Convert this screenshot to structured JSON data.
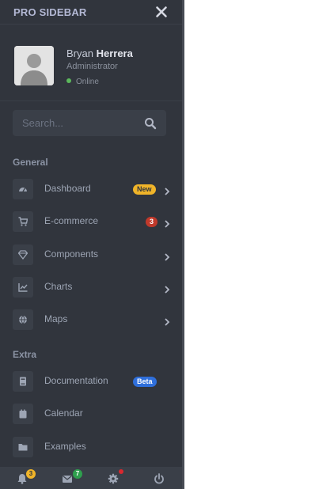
{
  "brand": {
    "title": "PRO SIDEBAR",
    "close_icon": "close-icon"
  },
  "user": {
    "first_name": "Bryan",
    "last_name": "Herrera",
    "role": "Administrator",
    "status": "Online",
    "status_color": "#5cb85c"
  },
  "search": {
    "placeholder": "Search...",
    "value": ""
  },
  "sections": [
    {
      "title": "General",
      "items": [
        {
          "label": "Dashboard",
          "icon": "tachometer-icon",
          "badge": "New",
          "badge_color": "#f0b429",
          "has_submenu": true
        },
        {
          "label": "E-commerce",
          "icon": "shopping-cart-icon",
          "badge": "3",
          "badge_color": "#c0392b",
          "has_submenu": true
        },
        {
          "label": "Components",
          "icon": "gem-icon",
          "badge": "",
          "has_submenu": true
        },
        {
          "label": "Charts",
          "icon": "chart-line-icon",
          "badge": "",
          "has_submenu": true
        },
        {
          "label": "Maps",
          "icon": "globe-icon",
          "badge": "",
          "has_submenu": true
        }
      ]
    },
    {
      "title": "Extra",
      "items": [
        {
          "label": "Documentation",
          "icon": "book-icon",
          "badge": "Beta",
          "badge_color": "#2f6fdb",
          "has_submenu": false
        },
        {
          "label": "Calendar",
          "icon": "calendar-icon",
          "badge": "",
          "has_submenu": false
        },
        {
          "label": "Examples",
          "icon": "folder-icon",
          "badge": "",
          "has_submenu": false
        }
      ]
    }
  ],
  "footer": {
    "notifications": {
      "icon": "bell-icon",
      "badge": "3",
      "badge_color": "#f0b429"
    },
    "messages": {
      "icon": "envelope-icon",
      "badge": "7",
      "badge_color": "#2e9f4d"
    },
    "settings": {
      "icon": "gear-icon",
      "dot_color": "#d9282f"
    },
    "power": {
      "icon": "power-icon"
    }
  },
  "colors": {
    "sidebar_bg": "#31353d",
    "item_bg": "#3a3f48",
    "text": "#818896"
  }
}
